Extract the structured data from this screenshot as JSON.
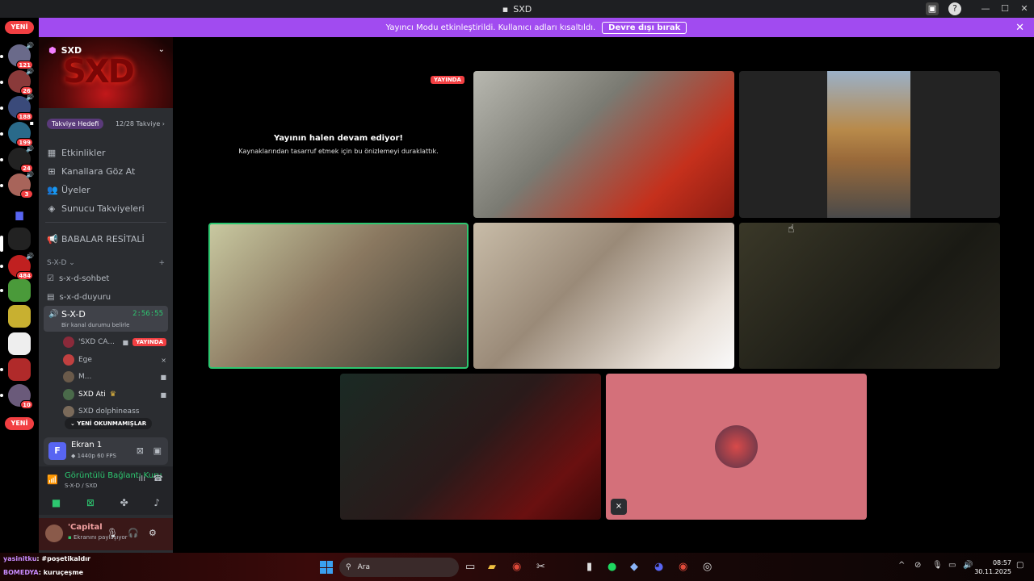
{
  "window": {
    "title": "SXD"
  },
  "banner": {
    "message": "Yayıncı Modu etkinleştirildi. Kullanıcı adları kısaltıldı.",
    "button": "Devre dışı bırak"
  },
  "rail": {
    "new_top": "YENİ",
    "new_bottom": "YENİ",
    "badges": [
      "121",
      "26",
      "188",
      "199",
      "24",
      "3",
      "484",
      "10"
    ]
  },
  "server": {
    "name": "SXD",
    "banner_logo": "SXD",
    "boost_goal": "Takviye Hedefi",
    "boost_count": "12/28 Takviye"
  },
  "nav": {
    "events": "Etkinlikler",
    "browse": "Kanallara Göz At",
    "members": "Üyeler",
    "boosts": "Sunucu Takviyeleri",
    "stage": "BABALAR RESİTALİ"
  },
  "category": {
    "name": "S-X-D"
  },
  "channels": {
    "sohbet": "s-x-d-sohbet",
    "duyuru": "s-x-d-duyuru"
  },
  "voice": {
    "name": "S-X-D",
    "timer": "2:56:55",
    "status": "Bir kanal durumu belirle",
    "users": [
      {
        "name": "'SXD CA...",
        "live": "YAYINDA"
      },
      {
        "name": "Ege"
      },
      {
        "name": "M..."
      },
      {
        "name": "SXD Ati"
      },
      {
        "name": "SXD dolphineass"
      }
    ],
    "unread": "YENİ OKUNMAMIŞLAR"
  },
  "stream": {
    "name": "Ekran 1",
    "quality": "1440p 60 FPS",
    "avatar_letter": "F"
  },
  "voice_conn": {
    "title": "Görüntülü Bağlantı Kuru",
    "sub": "S-X-D / SXD"
  },
  "user": {
    "name": "'Capital",
    "status": "Ekranını paylaşıyor"
  },
  "stage": {
    "live_tag": "YAYINDA",
    "paused_title": "Yayının halen devam ediyor!",
    "paused_text": "Kaynaklarından tasarruf etmek için bu önizlemeyi duraklattık."
  },
  "overlay": {
    "line1_user": "yasinitku",
    "line1_text": ": #poşetikaldır",
    "line2_user": "BOMEDYA",
    "line2_text": ": kuruçeşme"
  },
  "taskbar": {
    "search": "Ara",
    "time": "08:57",
    "date": "30.11.2025"
  }
}
